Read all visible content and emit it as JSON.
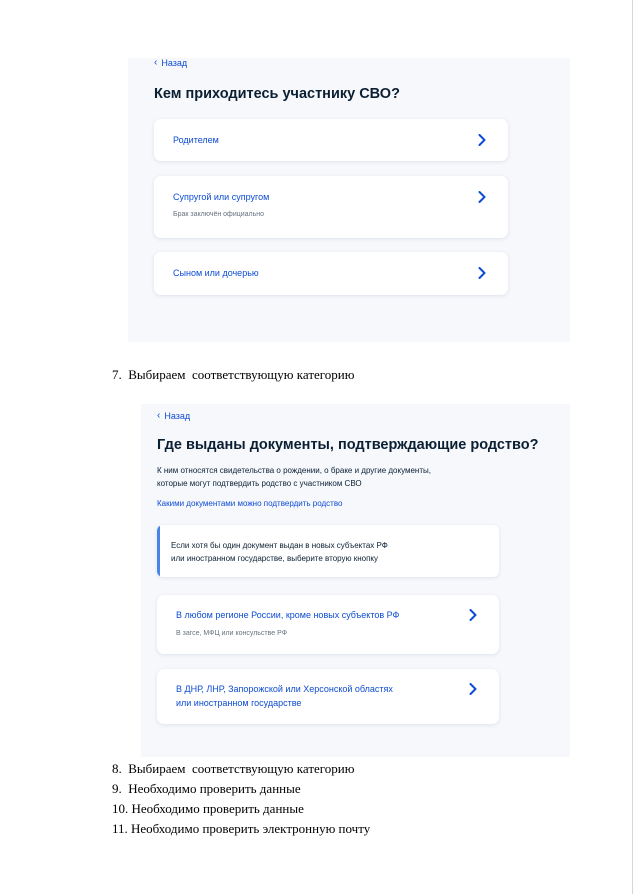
{
  "screen1": {
    "back_label": "Назад",
    "title": "Кем приходитесь участнику СВО?",
    "options": [
      {
        "label": "Родителем",
        "sublabel": ""
      },
      {
        "label": "Супругой или супругом",
        "sublabel": "Брак заключён официально"
      },
      {
        "label": "Сыном или дочерью",
        "sublabel": ""
      }
    ]
  },
  "step7": "7.  Выбираем  соответствующую категорию",
  "screen2": {
    "back_label": "Назад",
    "title": "Где выданы документы, подтверждающие родство?",
    "description_line1": "К ним относятся свидетельства о рождении, о браке и другие документы,",
    "description_line2": "которые могут подтвердить родство с участником СВО",
    "link": "Какими документами можно подтвердить родство",
    "info_line1": "Если хотя бы один документ выдан в новых субъектах РФ",
    "info_line2": "или иностранном государстве, выберите вторую кнопку",
    "options": [
      {
        "line1": "В любом регионе России, кроме новых субъектов РФ",
        "line2": "",
        "sublabel": "В загсе, МФЦ или консульстве РФ"
      },
      {
        "line1": "В ДНР, ЛНР, Запорожской или Херсонской областях",
        "line2": "или иностранном государстве",
        "sublabel": ""
      }
    ]
  },
  "steps": [
    "8.  Выбираем  соответствующую категорию",
    "9.  Необходимо проверить данные",
    "10. Необходимо проверить данные",
    "11. Необходимо проверить электронную почту"
  ],
  "colors": {
    "link_blue": "#0d4cd3",
    "panel_bg": "#f6f8fc",
    "accent_bar": "#4a84e8",
    "text_dark": "#0b1f33"
  }
}
